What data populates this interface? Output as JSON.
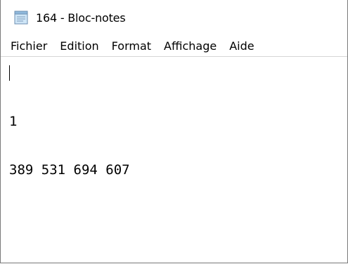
{
  "window": {
    "title": "164 - Bloc-notes",
    "icon": "notepad-icon"
  },
  "menubar": {
    "items": [
      {
        "label": "Fichier"
      },
      {
        "label": "Edition"
      },
      {
        "label": "Format"
      },
      {
        "label": "Affichage"
      },
      {
        "label": "Aide"
      }
    ]
  },
  "editor": {
    "lines": [
      "1",
      "389 531 694 607"
    ]
  }
}
